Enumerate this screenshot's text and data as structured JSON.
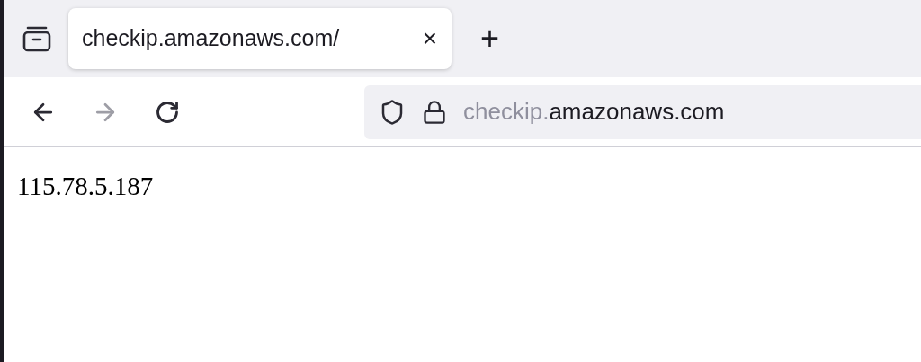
{
  "tabs": [
    {
      "title": "checkip.amazonaws.com/",
      "selected": true
    }
  ],
  "close_tab": "×",
  "new_tab": "+",
  "nav_buttons": [
    {
      "kind": "back",
      "disabled": false
    },
    {
      "kind": "forward",
      "disabled": true
    },
    {
      "kind": "reload",
      "disabled": false
    }
  ],
  "address_bar": {
    "subdomain": "checkip.",
    "domain": "amazonaws.com"
  },
  "page": {
    "text": "115.78.5.187"
  }
}
